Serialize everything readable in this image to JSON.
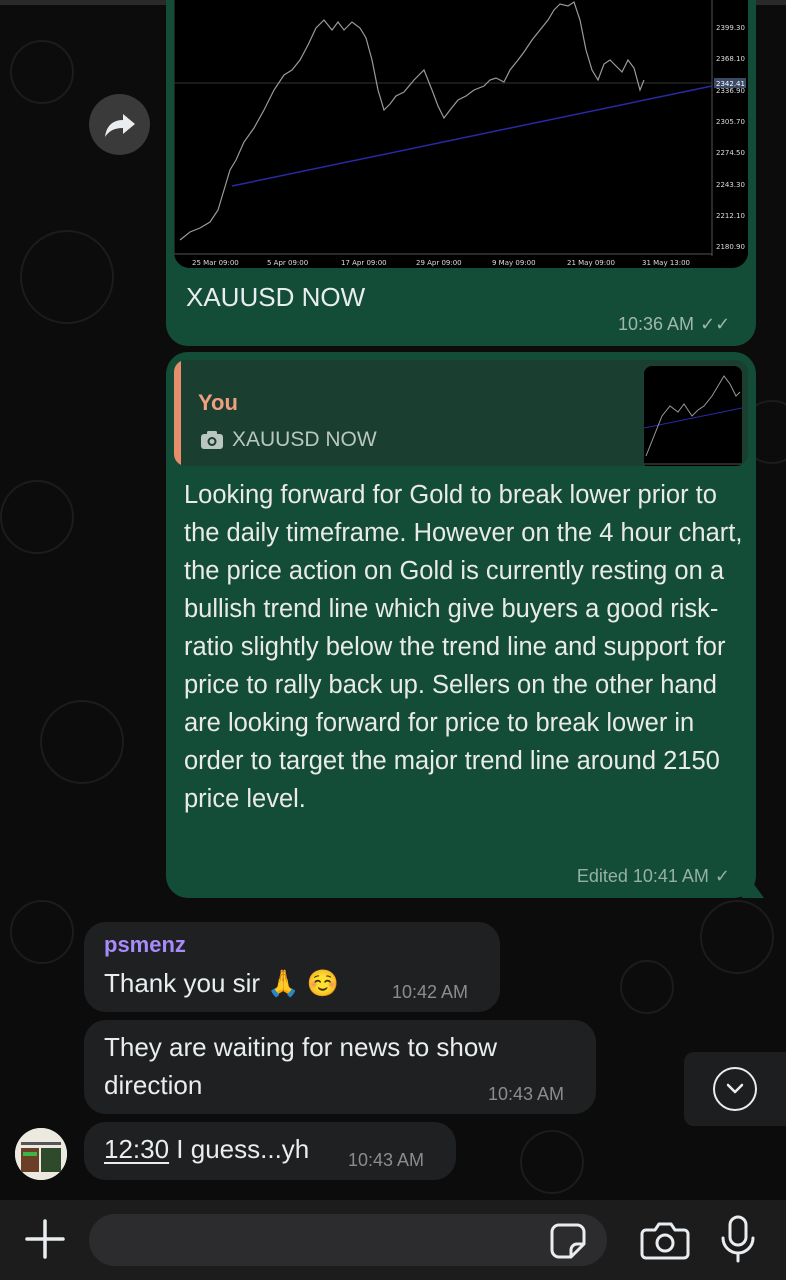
{
  "chat": {
    "image_message": {
      "caption": "XAUUSD NOW",
      "time": "10:36 AM",
      "ticks": "✓✓",
      "chart_x_labels": [
        "25 Mar 09:00",
        "5 Apr 09:00",
        "17 Apr 09:00",
        "29 Apr 09:00",
        "9 May 09:00",
        "21 May 09:00",
        "31 May 13:00"
      ],
      "chart_y_labels": [
        "2399.30",
        "2368.10",
        "2336.90",
        "2305.70",
        "2274.50",
        "2243.30",
        "2212.10",
        "2180.90"
      ],
      "chart_price_tag": "2342.41"
    },
    "reply_message": {
      "quote_author": "You",
      "quote_text": "XAUUSD NOW",
      "text": "Looking forward for Gold to break lower prior to the daily timeframe. However on the 4 hour chart, the price action on Gold is currently resting on a bullish trend line which give buyers a good risk-ratio slightly below the trend line and support for price to rally back up. Sellers on the other hand are looking forward for price to break lower in order to target the major trend line around 2150 price level.",
      "meta": "Edited 10:41 AM",
      "ticks": "✓"
    },
    "incoming": [
      {
        "sender": "psmenz",
        "text": "Thank you sir 🙏 ☺️",
        "time": "10:42 AM"
      },
      {
        "text": "They are waiting for news to show direction",
        "time": "10:43 AM"
      },
      {
        "link": "12:30",
        "text": " I guess...yh",
        "time": "10:43 AM"
      }
    ]
  },
  "composer": {
    "placeholder": ""
  },
  "colors": {
    "outgoing_bubble": "#144d37",
    "incoming_bubble": "#1f2021",
    "sender_name": "#a78bfa",
    "quote_author": "#f0a07e"
  },
  "icons": [
    "forward-icon",
    "camera-icon",
    "chevron-down-icon",
    "plus-icon",
    "sticker-icon",
    "mic-icon"
  ]
}
